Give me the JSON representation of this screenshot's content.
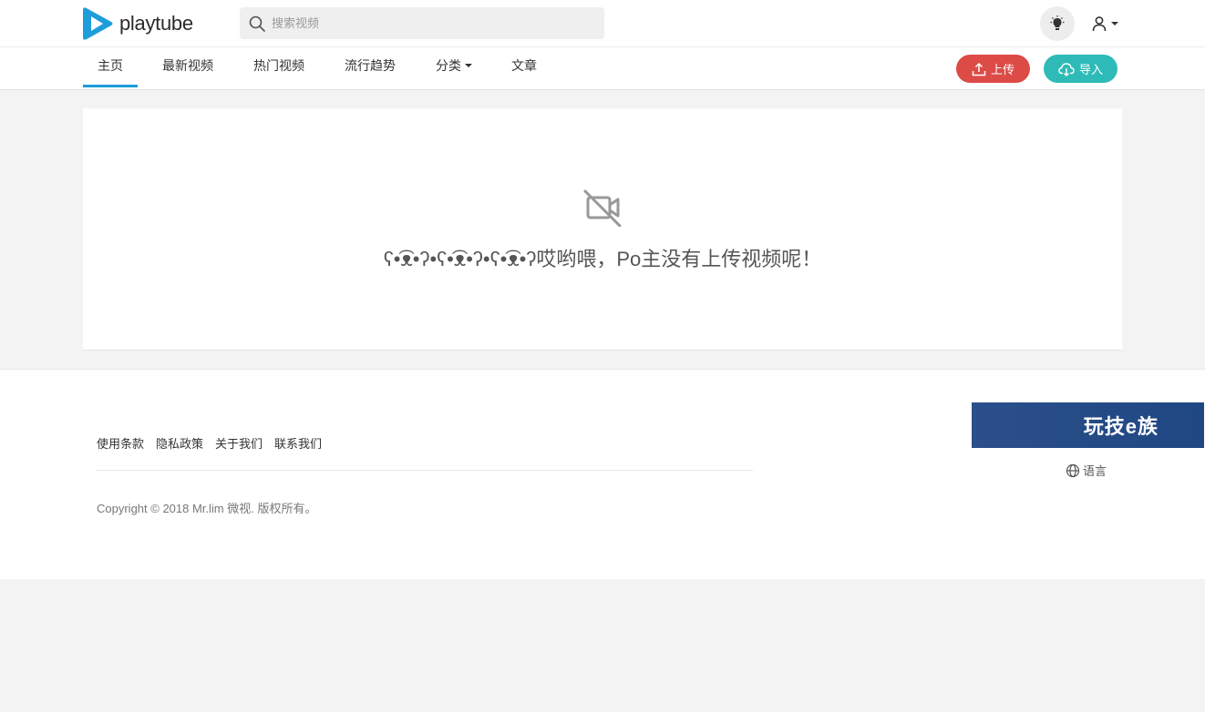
{
  "header": {
    "logo_text_play": "play",
    "logo_text_tube": "tube",
    "search_placeholder": "搜索视频",
    "theme_icon": "lightbulb-icon",
    "user_icon": "user-icon"
  },
  "nav": {
    "items": [
      {
        "label": "主页",
        "active": true
      },
      {
        "label": "最新视频"
      },
      {
        "label": "热门视频"
      },
      {
        "label": "流行趋势"
      },
      {
        "label": "分类"
      },
      {
        "label": "文章"
      }
    ],
    "upload_label": "上传",
    "import_label": "导入",
    "upload_color": "#dd4b47",
    "import_color": "#2ebbb7",
    "active_color": "#1e9ddb"
  },
  "main": {
    "empty_icon": "video-off-icon",
    "empty_message": "ʕ•͡ᴥ•ʔ•ʕ•͡ᴥ•ʔ•ʕ•͡ᴥ•ʔ哎哟喂，Po主没有上传视频呢！"
  },
  "footer": {
    "links": [
      "使用条款",
      "隐私政策",
      "关于我们",
      "联系我们"
    ],
    "copyright": "Copyright © 2018 Mr.lim 微视. 版权所有。",
    "banner_text": "玩技e族",
    "language_label": "语言"
  }
}
